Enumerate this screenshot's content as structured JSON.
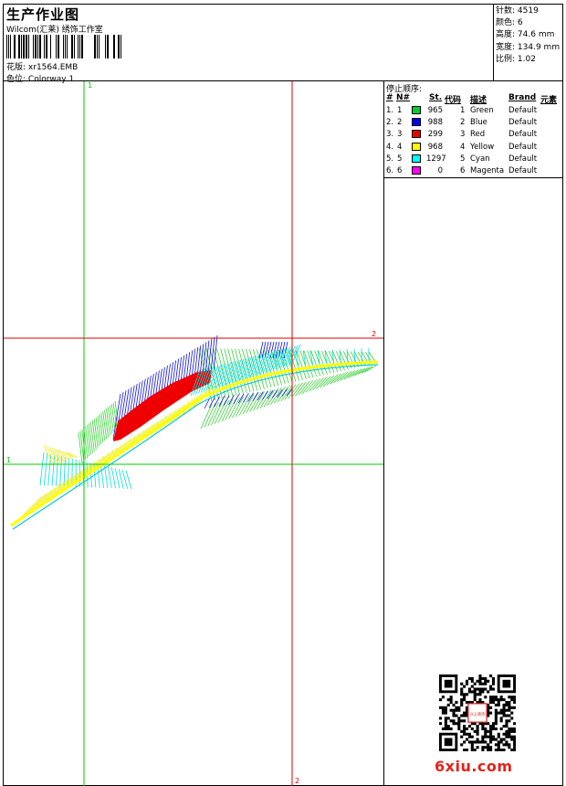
{
  "sheet": {
    "title": "生产作业图",
    "company": "Wilcom(汇莱) 绣饰工作室",
    "design_label": "花版:",
    "design_file": "xr1564.EMB",
    "colorway_label": "色位:",
    "colorway": "Colorway 1"
  },
  "stats": [
    {
      "label": "针数:",
      "value": "4519"
    },
    {
      "label": "颜色:",
      "value": "6"
    },
    {
      "label": "高度:",
      "value": "74.6 mm"
    },
    {
      "label": "宽度:",
      "value": "134.9 mm"
    },
    {
      "label": "比例:",
      "value": "1.02"
    }
  ],
  "stop_sequence": {
    "title": "停止顺序:",
    "headers": {
      "hash": "#",
      "n": "N#",
      "st": "St.",
      "code": "代码",
      "desc": "描述",
      "brand": "Brand",
      "element": "元素"
    },
    "rows": [
      {
        "idx": "1.",
        "n": "1",
        "color": "#00cc33",
        "st": "965",
        "code": "1",
        "desc": "Green",
        "brand": "Default"
      },
      {
        "idx": "2.",
        "n": "2",
        "color": "#0000ee",
        "st": "988",
        "code": "2",
        "desc": "Blue",
        "brand": "Default"
      },
      {
        "idx": "3.",
        "n": "3",
        "color": "#ee0000",
        "st": "299",
        "code": "3",
        "desc": "Red",
        "brand": "Default"
      },
      {
        "idx": "4.",
        "n": "4",
        "color": "#ffff00",
        "st": "968",
        "code": "4",
        "desc": "Yellow",
        "brand": "Default"
      },
      {
        "idx": "5.",
        "n": "5",
        "color": "#00ffff",
        "st": "1297",
        "code": "5",
        "desc": "Cyan",
        "brand": "Default"
      },
      {
        "idx": "6.",
        "n": "6",
        "color": "#ff00ff",
        "st": "0",
        "code": "6",
        "desc": "Magenta",
        "brand": "Default"
      }
    ]
  },
  "guides": {
    "green_label": "1",
    "red_label": "2",
    "green_color": "#00cc00",
    "red_color": "#dd0000"
  },
  "watermark": {
    "site": "6xiu.com",
    "seal_text": "以上装饰",
    "color": "#e2231a"
  }
}
